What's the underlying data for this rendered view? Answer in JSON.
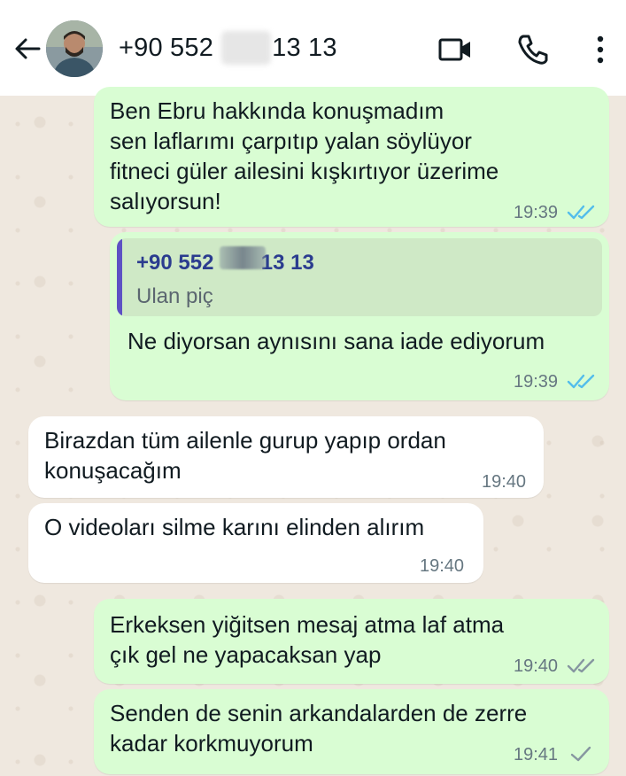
{
  "header": {
    "contact_part1": "+90 552",
    "contact_part2": "13 13",
    "back_icon": "arrow-left-icon",
    "video_icon": "video-camera-icon",
    "call_icon": "phone-icon",
    "more_icon": "vertical-dots-icon"
  },
  "messages": [
    {
      "direction": "outgoing",
      "text": "Ben Ebru hakkında konuşmadım\nsen laflarımı çarpıtıp yalan söylüyor\nfitneci güler ailesini kışkırtıyor üzerime\nsalıyorsun!",
      "time": "19:39",
      "status": "read"
    },
    {
      "direction": "outgoing",
      "quote_name_part1": "+90 552",
      "quote_name_part2": "13 13",
      "quote_text": "Ulan piç",
      "text": "Ne diyorsan aynısını sana iade ediyorum",
      "time": "19:39",
      "status": "read"
    },
    {
      "direction": "incoming",
      "text": "Birazdan tüm ailenle gurup yapıp ordan\nkonuşacağım",
      "time": "19:40"
    },
    {
      "direction": "incoming",
      "text": "O videoları silme karını elinden alırım",
      "time": "19:40"
    },
    {
      "direction": "outgoing",
      "text": "Erkeksen yiğitsen mesaj atma laf atma\nçık gel ne yapacaksan yap",
      "time": "19:40",
      "status": "delivered"
    },
    {
      "direction": "outgoing",
      "text": "Senden de senin arkandalarden de zerre\nkadar korkmuyorum",
      "time": "19:41",
      "status": "sent"
    }
  ],
  "colors": {
    "outgoing_bubble": "#d9fdd3",
    "incoming_bubble": "#ffffff",
    "read_ticks": "#53bdeb",
    "grey_ticks": "#8696a0",
    "quote_bar": "#5e51c4"
  }
}
